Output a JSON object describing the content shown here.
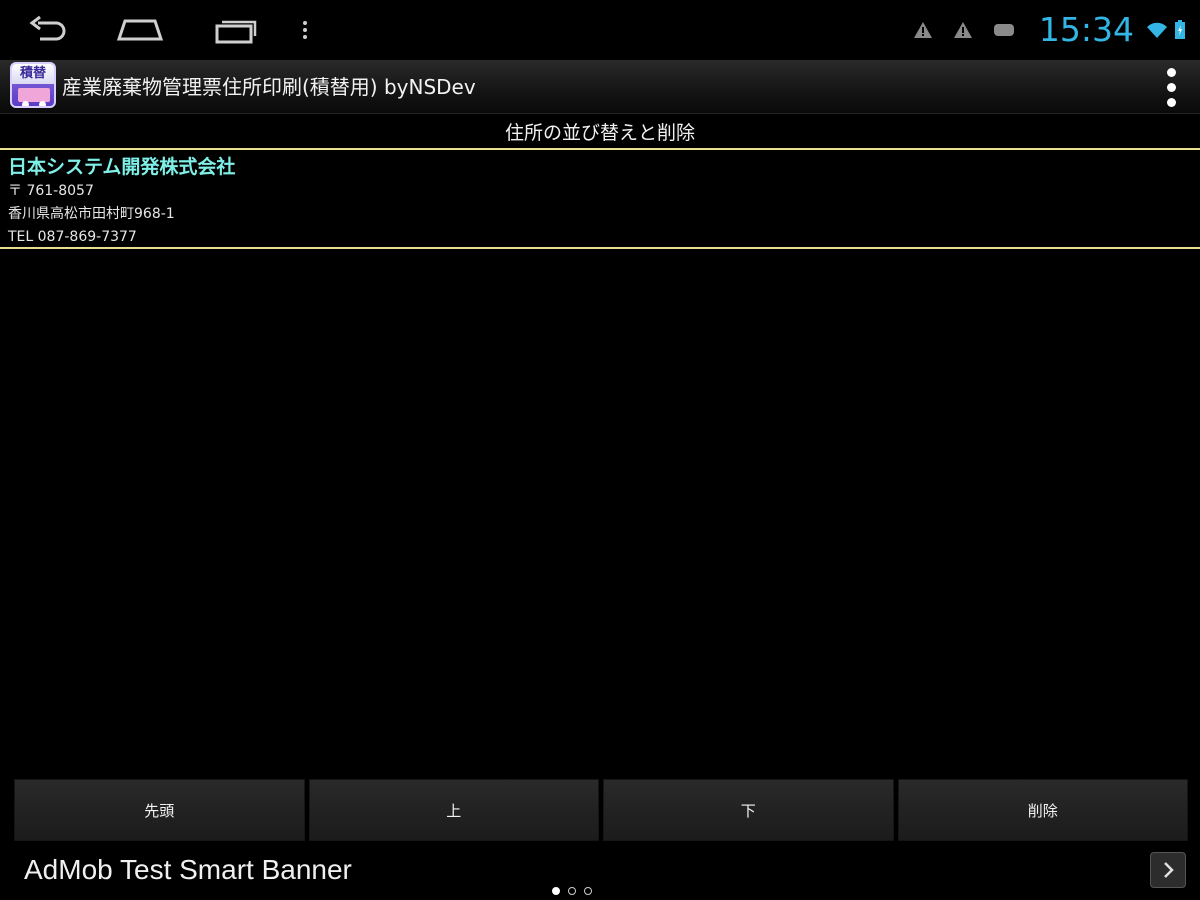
{
  "status_bar": {
    "time": "15:34",
    "icons": [
      "warning-icon",
      "warning-icon",
      "message-icon",
      "wifi-icon",
      "battery-icon"
    ],
    "clock_color": "#33b5e5"
  },
  "nav_bar": {
    "icons": [
      "back-icon",
      "home-icon",
      "recents-icon",
      "menu-icon"
    ]
  },
  "action_bar": {
    "app_icon_text": "積替",
    "title": "産業廃棄物管理票住所印刷(積替用) byNSDev"
  },
  "section": {
    "title": "住所の並び替えと削除"
  },
  "addresses": [
    {
      "name": "日本システム開発株式会社",
      "postal": "〒 761-8057",
      "address": "香川県高松市田村町968-1",
      "tel": "TEL 087-869-7377"
    }
  ],
  "buttons": {
    "first": "先頭",
    "up": "上",
    "down": "下",
    "delete": "削除"
  },
  "ad": {
    "text": "AdMob Test Smart Banner"
  },
  "colors": {
    "accent": "#33b5e5",
    "name_text": "#7ff0e8",
    "list_border": "#e8e08c"
  }
}
